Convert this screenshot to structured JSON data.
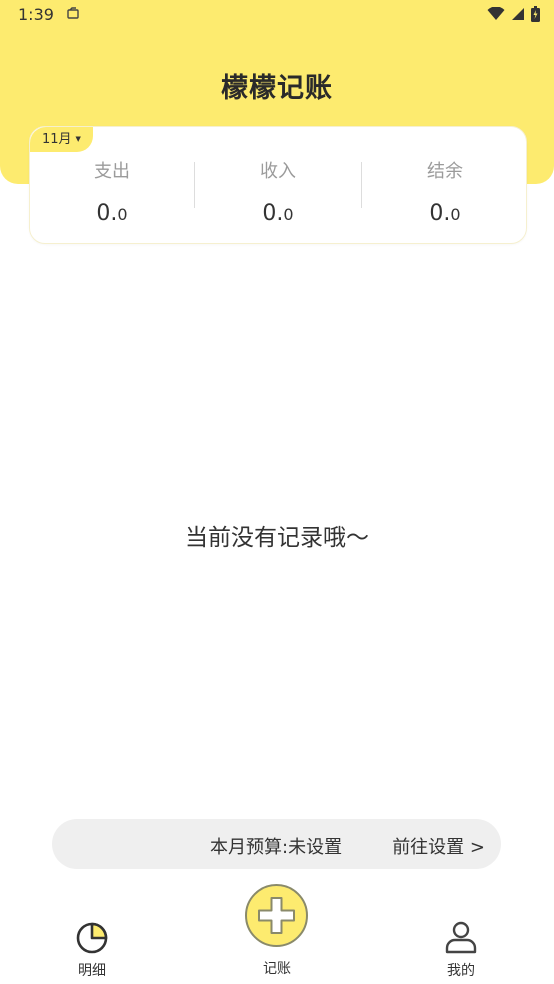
{
  "status_bar": {
    "time": "1:39"
  },
  "app": {
    "title": "檬檬记账"
  },
  "summary": {
    "month": "11月",
    "expense": {
      "label": "支出",
      "value_int": "0.",
      "value_dec": "0"
    },
    "income": {
      "label": "收入",
      "value_int": "0.",
      "value_dec": "0"
    },
    "balance": {
      "label": "结余",
      "value_int": "0.",
      "value_dec": "0"
    }
  },
  "empty_state": {
    "message": "当前没有记录哦～"
  },
  "budget": {
    "text": "本月预算:未设置",
    "link": "前往设置 >"
  },
  "tabs": {
    "details": {
      "label": "明细"
    },
    "add": {
      "label": "记账"
    },
    "mine": {
      "label": "我的"
    }
  },
  "colors": {
    "accent": "#fdeb6f",
    "text": "#333333",
    "muted": "#9b9b9b"
  }
}
